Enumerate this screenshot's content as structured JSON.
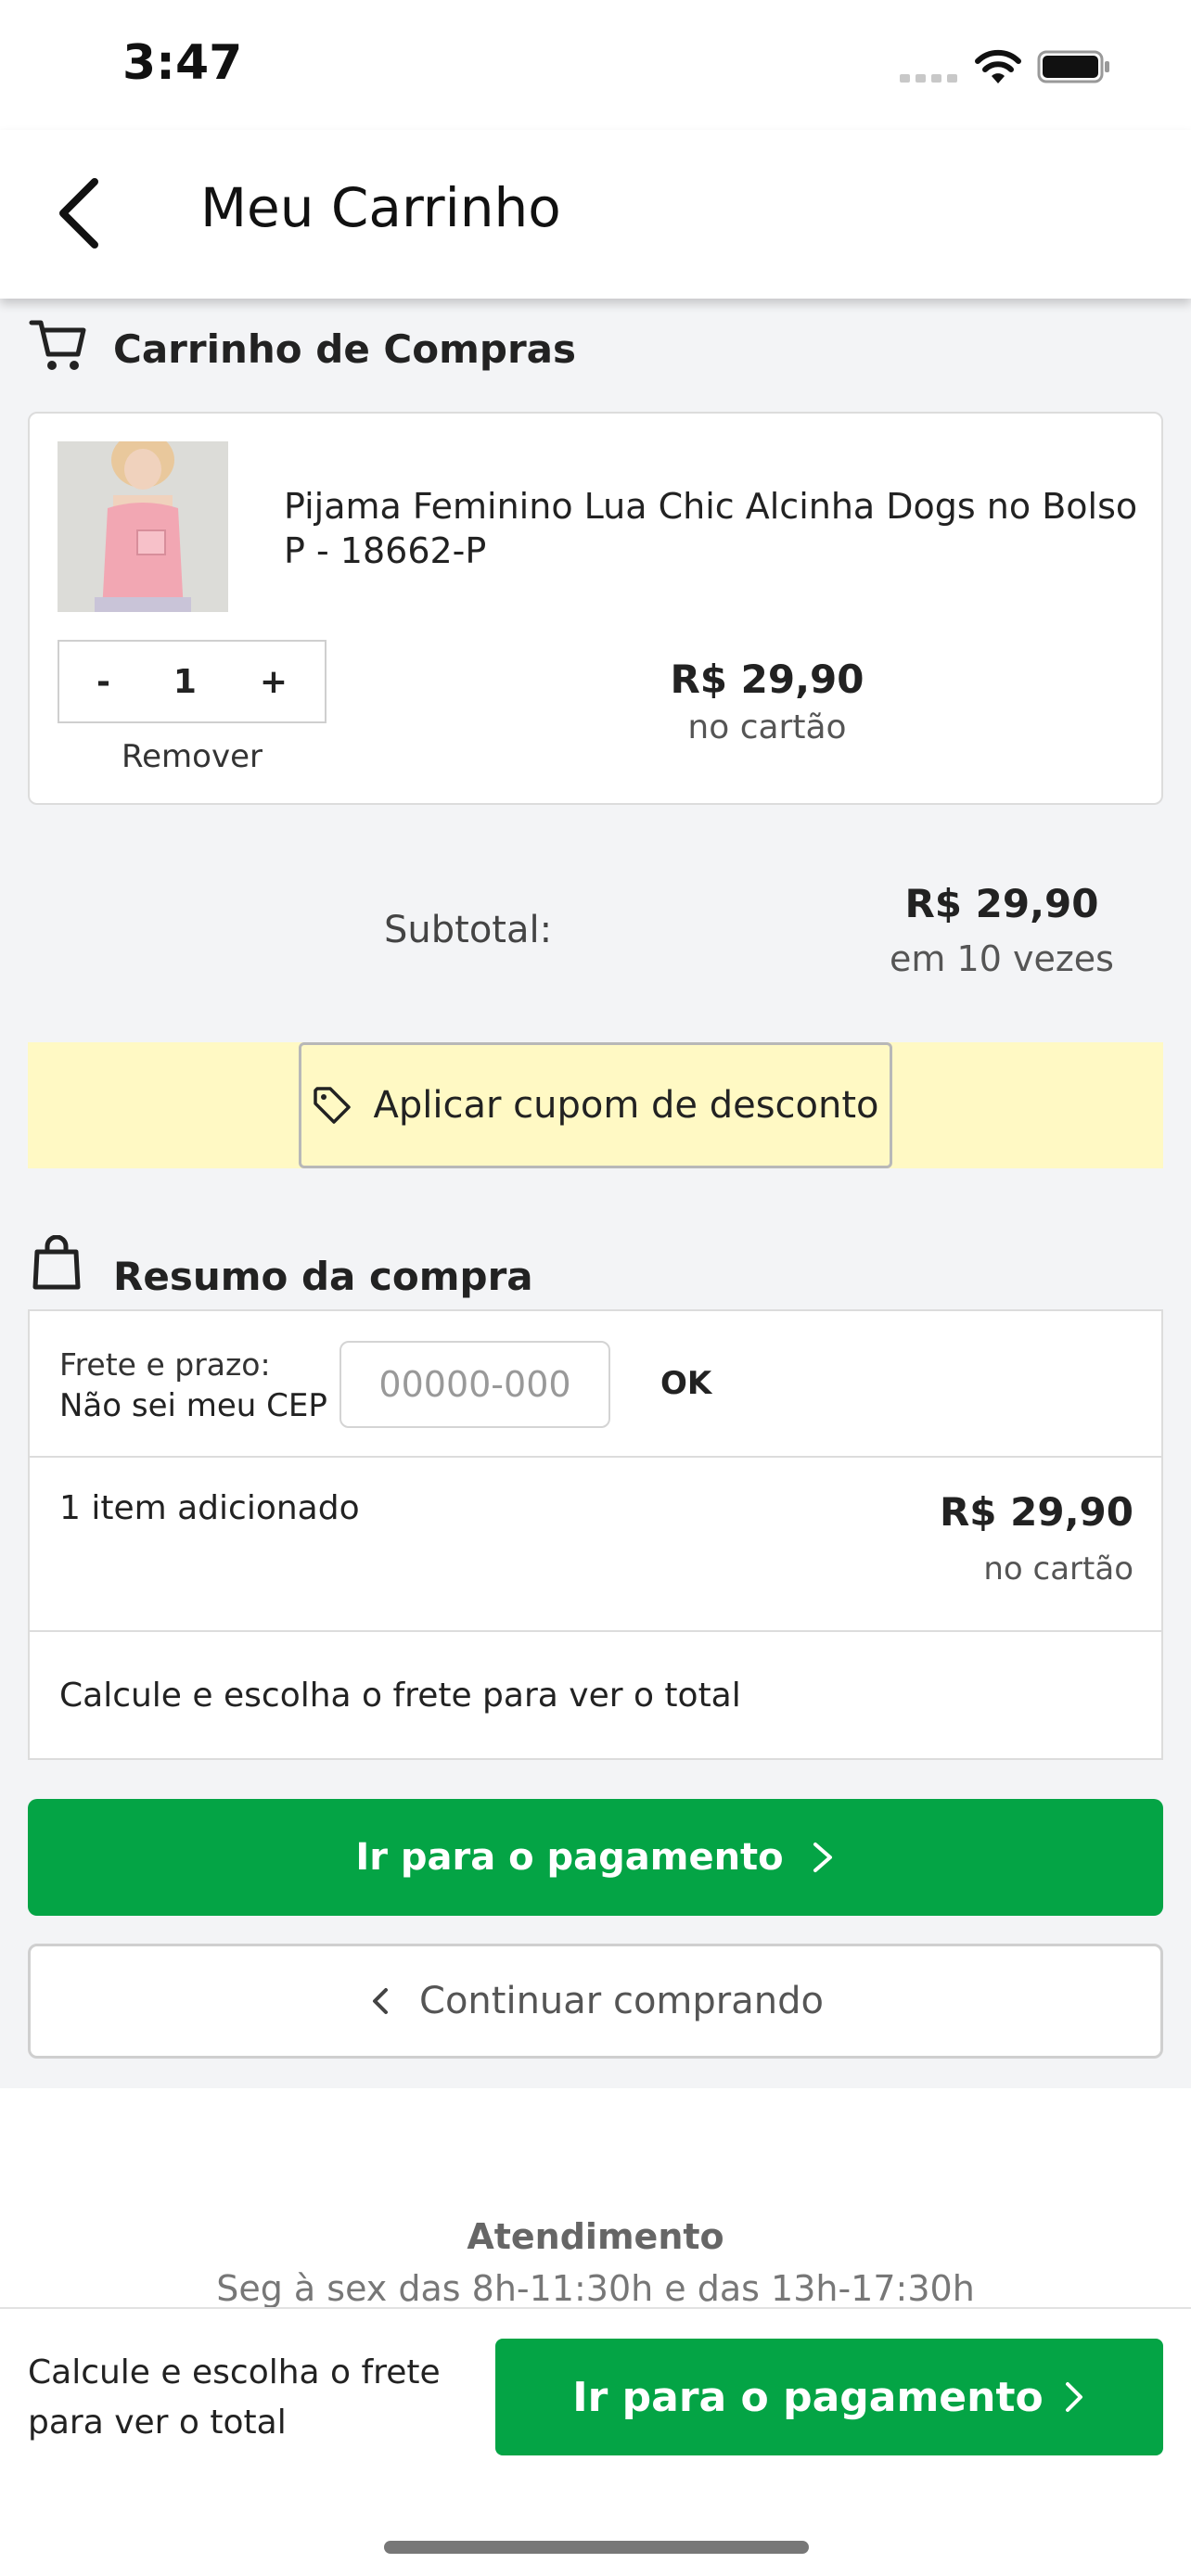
{
  "status_bar": {
    "time": "3:47"
  },
  "nav": {
    "title": "Meu Carrinho"
  },
  "cart": {
    "title": "Carrinho de Compras",
    "item": {
      "name": "Pijama Feminino Lua Chic Alcinha Dogs no Bolso P - 18662-P",
      "qty_minus": "-",
      "qty": "1",
      "qty_plus": "+",
      "remove": "Remover",
      "price": "R$ 29,90",
      "price_note": "no cartão"
    }
  },
  "subtotal": {
    "label": "Subtotal:",
    "value": "R$ 29,90",
    "note": "em 10 vezes"
  },
  "coupon": {
    "label": "Aplicar cupom de desconto"
  },
  "summary": {
    "title": "Resumo da compra",
    "frete_label": "Frete e prazo:",
    "cep_link": "Não sei meu CEP",
    "cep_placeholder": "00000-000",
    "ok": "OK",
    "items_label": "1 item adicionado",
    "items_price": "R$ 29,90",
    "items_note": "no cartão",
    "calc_text": "Calcule e escolha o frete para ver o total"
  },
  "actions": {
    "pay": "Ir para o pagamento",
    "continue": "Continuar comprando"
  },
  "footer": {
    "title": "Atendimento",
    "hours": "Seg à sex das 8h-11:30h e das 13h-17:30h"
  },
  "bottom_bar": {
    "text": "Calcule e escolha o frete para ver o total",
    "pay": "Ir para o pagamento"
  },
  "colors": {
    "primary_green": "#04a445",
    "coupon_band": "#fff9c4",
    "background": "#f3f4f6"
  }
}
